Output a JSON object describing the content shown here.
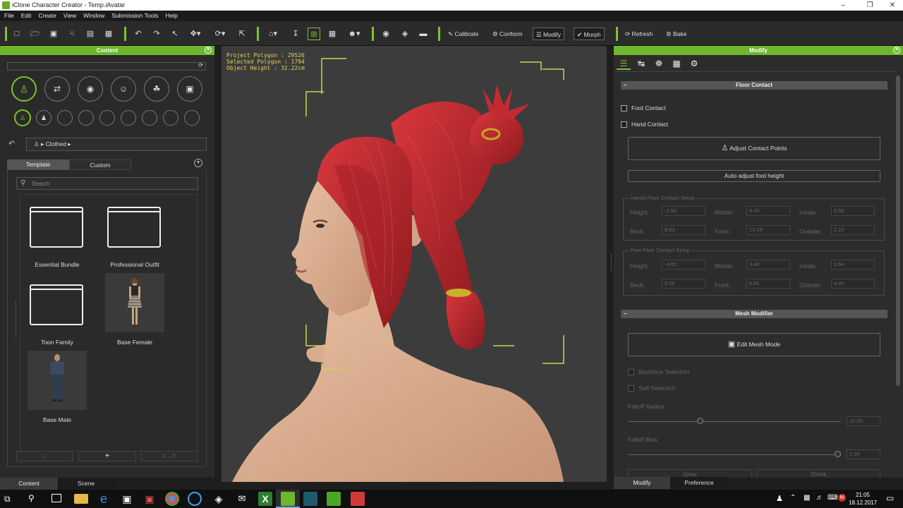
{
  "window": {
    "title": "iClone Character Creator - Temp.iAvatar"
  },
  "menu": [
    "File",
    "Edit",
    "Create",
    "View",
    "Window",
    "Submission Tools",
    "Help"
  ],
  "toolbar": {
    "calibrate": "Calibrate",
    "conform": "Conform",
    "modify": "Modify",
    "morph": "Morph",
    "refresh": "Refresh",
    "bake": "Bake"
  },
  "content_panel": {
    "title": "Content",
    "breadcrumb": "Clothed",
    "tabs": [
      "Template",
      "Custom"
    ],
    "search_placeholder": "Search",
    "items": [
      {
        "label": "Essential Bundle",
        "kind": "folder"
      },
      {
        "label": "Professional Outfit",
        "kind": "folder"
      },
      {
        "label": "Toon Family",
        "kind": "folder"
      },
      {
        "label": "Base Female",
        "kind": "thumbnail"
      },
      {
        "label": "Base Male",
        "kind": "thumbnail"
      }
    ],
    "bottom_tabs": [
      "Content",
      "Scene"
    ]
  },
  "viewport": {
    "project_polygon": "Project Polygon : 29526",
    "selected_polygon": "Selected Polygon : 1794",
    "object_height": "Object Height : 32.22cm"
  },
  "modify_panel": {
    "title": "Modify",
    "floor_contact": {
      "section": "Floor Contact",
      "foot_contact": "Foot Contact",
      "hand_contact": "Hand Contact",
      "adjust_contact_points": "Adjust Contact Points",
      "auto_adjust": "Auto adjust foot height",
      "hands_setup": {
        "title": "Hands Floor Contact Setup",
        "rows": [
          {
            "l1": "Height:",
            "v1": "-2.94",
            "l2": "Middle:",
            "v2": "8.43",
            "l3": "Inside:",
            "v3": "8.68"
          },
          {
            "l1": "Back:",
            "v1": "8.83",
            "l2": "Front:",
            "v2": "10.16",
            "l3": "Outside:",
            "v3": "2.15"
          }
        ]
      },
      "feet_setup": {
        "title": "Feet Floor Contact Setup",
        "rows": [
          {
            "l1": "Height:",
            "v1": "-4.65",
            "l2": "Middle:",
            "v2": "3.44",
            "l3": "Inside:",
            "v3": "3.64"
          },
          {
            "l1": "Back:",
            "v1": "5.05",
            "l2": "Front:",
            "v2": "8.81",
            "l3": "Outside:",
            "v3": "4.90"
          }
        ]
      }
    },
    "mesh_modifier": {
      "section": "Mesh Modifier",
      "edit_mesh_mode": "Edit Mesh Mode",
      "backface_selection": "Backface Selection",
      "soft_selection": "Soft Selection",
      "falloff_radius": "Falloff Radius",
      "falloff_radius_value": "10.00",
      "falloff_bias": "Falloff Bias",
      "falloff_bias_value": "1.00",
      "grow": "Grow",
      "shrink": "Shrink"
    },
    "bottom_tabs": [
      "Modify",
      "Preference"
    ]
  },
  "taskbar": {
    "time": "21:05",
    "date": "18.12.2017"
  },
  "colors": {
    "accent": "#6eb72c",
    "hair": "#b8232a",
    "skin": "#e2b496",
    "info_text": "#e3d25a"
  }
}
